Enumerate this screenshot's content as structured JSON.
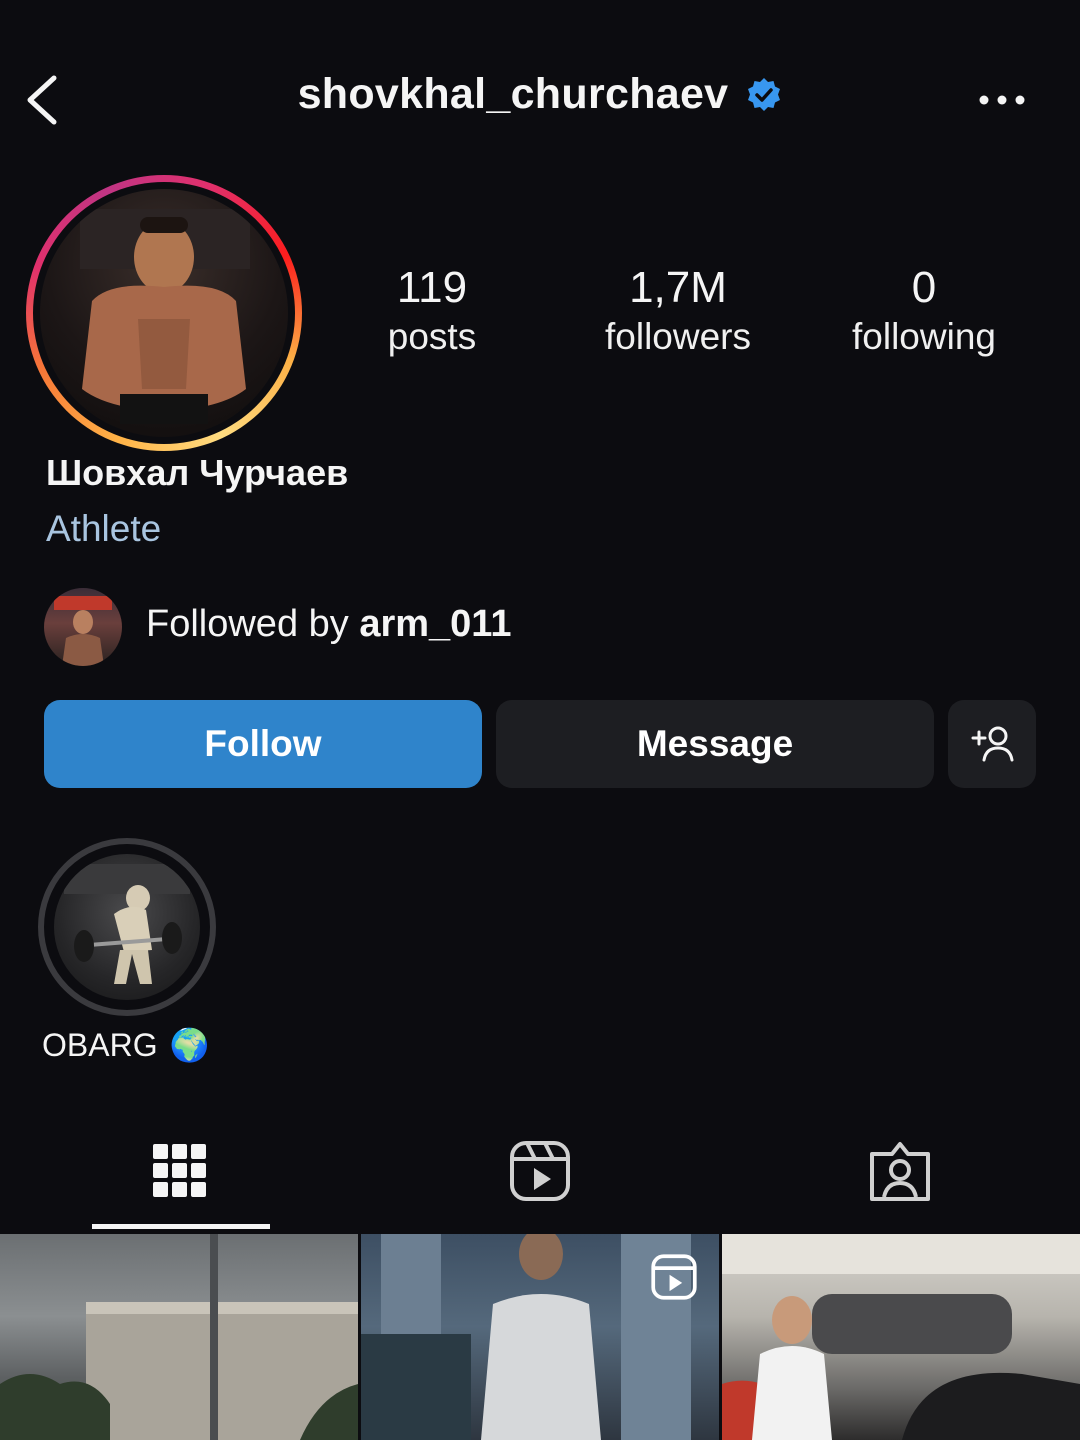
{
  "header": {
    "username": "shovkhal_churchaev",
    "verified": true,
    "icons": {
      "back": "chevron-left-icon",
      "verified": "verified-badge-icon",
      "more": "more-horizontal-icon"
    },
    "colors": {
      "verified": "#3897f0"
    }
  },
  "profile": {
    "full_name": "Шовхал Чурчаев",
    "category": "Athlete",
    "stats": {
      "posts": {
        "value": "119",
        "label": "posts"
      },
      "followers": {
        "value": "1,7M",
        "label": "followers"
      },
      "following": {
        "value": "0",
        "label": "following"
      }
    }
  },
  "followed_by": {
    "prefix": "Followed by ",
    "username": "arm_011"
  },
  "actions": {
    "follow_label": "Follow",
    "message_label": "Message",
    "add_user_icon": "add-user-icon",
    "colors": {
      "follow_bg": "#2f84cb",
      "secondary_bg": "#1d1e22"
    }
  },
  "highlights": [
    {
      "label": "OBARG",
      "emoji": "🌍"
    }
  ],
  "tabs": [
    {
      "name": "grid",
      "icon": "grid-icon",
      "active": true
    },
    {
      "name": "reels",
      "icon": "reels-icon",
      "active": false
    },
    {
      "name": "tagged",
      "icon": "tagged-icon",
      "active": false
    }
  ],
  "posts_grid": [
    {
      "type": "photo"
    },
    {
      "type": "reel"
    },
    {
      "type": "photo"
    }
  ]
}
